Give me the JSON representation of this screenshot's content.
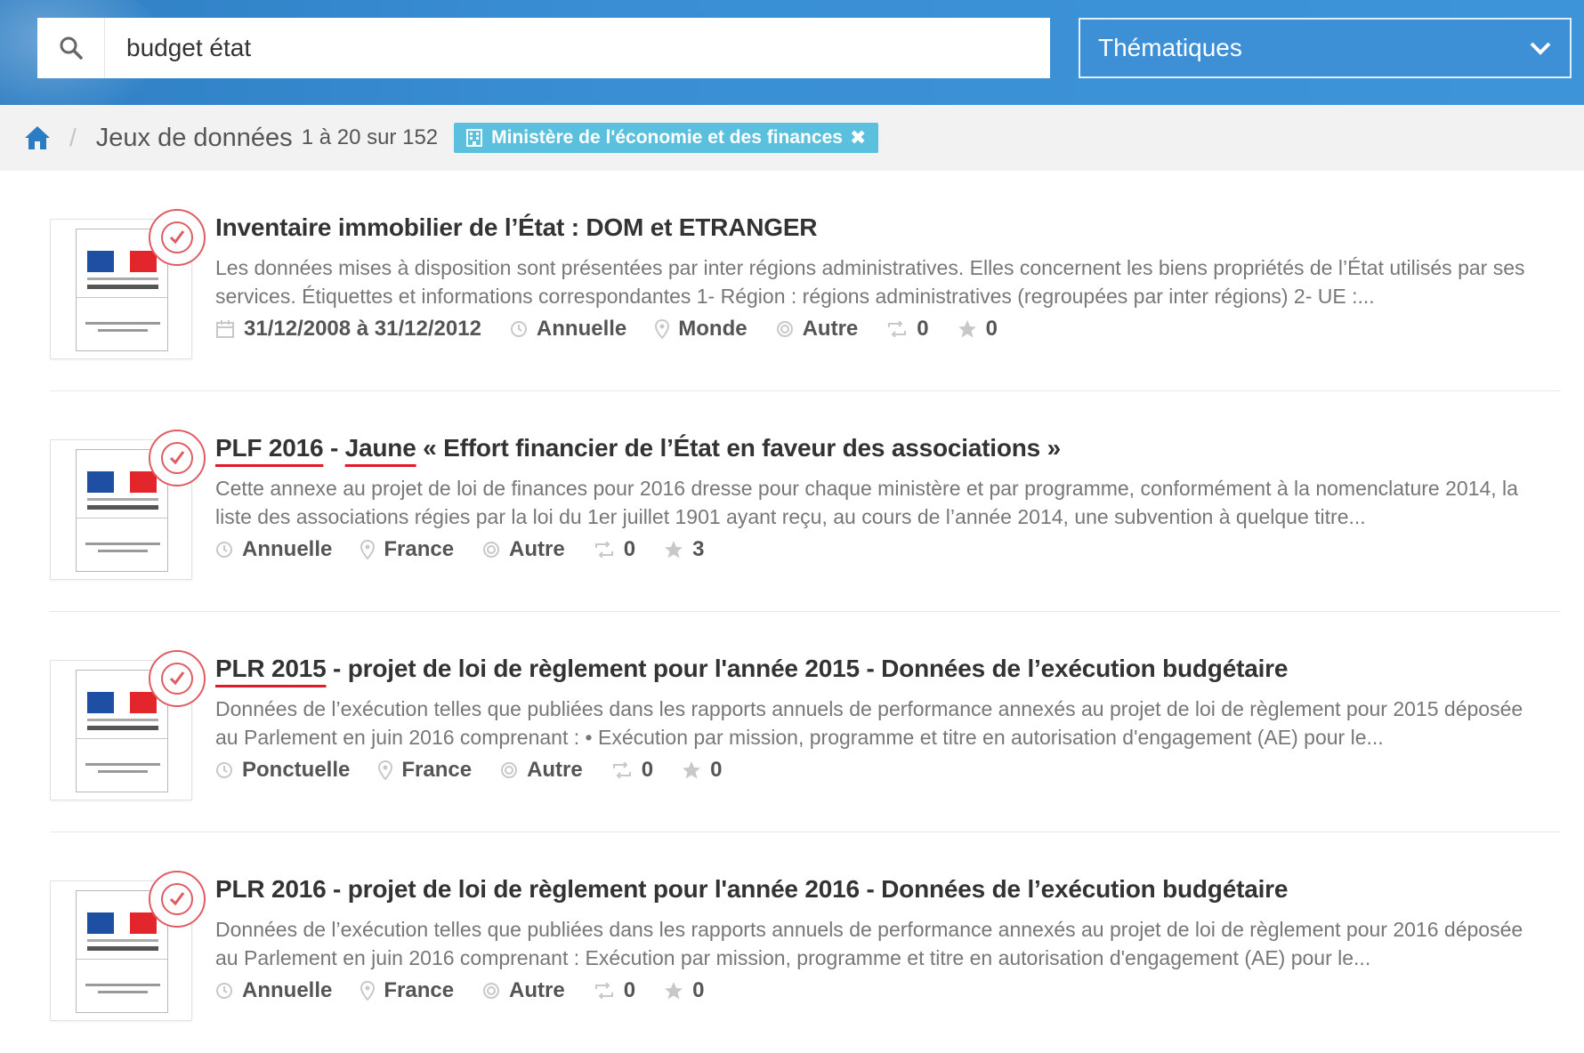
{
  "search": {
    "value": "budget état",
    "placeholder": ""
  },
  "theme_select": {
    "selected": "Thématiques"
  },
  "breadcrumb": {
    "title": "Jeux de données",
    "count": "1 à 20 sur 152",
    "filter_tag": "Ministère de l'économie et des finances"
  },
  "colors": {
    "header_blue": "#3a8fd4",
    "tag_blue": "#5bc0de",
    "highlight_red": "#e0192b",
    "seal_red": "#e05c63"
  },
  "results": [
    {
      "title_parts": [
        {
          "text": "Inventaire immobilier de l’État : DOM et ETRANGER",
          "highlight": false
        }
      ],
      "description": "Les données mises à disposition sont présentées par inter régions administratives. Elles concernent les biens propriétés de l’État utilisés par ses services. Étiquettes et informations correspondantes 1- Région : régions administratives (regroupées par inter régions) 2- UE :...",
      "temporal": "31/12/2008 à 31/12/2012",
      "frequency": "Annuelle",
      "spatial": "Monde",
      "license": "Autre",
      "reuses": "0",
      "stars": "0"
    },
    {
      "title_parts": [
        {
          "text": "PLF 2016",
          "highlight": true
        },
        {
          "text": " - ",
          "highlight": false
        },
        {
          "text": "Jaune",
          "highlight": true
        },
        {
          "text": " « Effort financier de l’État en faveur des associations »",
          "highlight": false
        }
      ],
      "description": "Cette annexe au projet de loi de finances pour 2016 dresse pour chaque ministère et par programme, conformément à la nomenclature 2014, la liste des associations régies par la loi du 1er juillet 1901 ayant reçu, au cours de l’année 2014, une subvention à quelque titre...",
      "temporal": "",
      "frequency": "Annuelle",
      "spatial": "France",
      "license": "Autre",
      "reuses": "0",
      "stars": "3"
    },
    {
      "title_parts": [
        {
          "text": "PLR 2015",
          "highlight": true
        },
        {
          "text": " - projet de loi de règlement pour l'année 2015 - Données de l’exécution budgétaire",
          "highlight": false
        }
      ],
      "description": "Données de l’exécution telles que publiées dans les rapports annuels de performance annexés au projet de loi de règlement pour 2015 déposée au Parlement en juin 2016 comprenant : • Exécution par mission, programme et titre en autorisation d'engagement (AE) pour le...",
      "temporal": "",
      "frequency": "Ponctuelle",
      "spatial": "France",
      "license": "Autre",
      "reuses": "0",
      "stars": "0"
    },
    {
      "title_parts": [
        {
          "text": "PLR 2016 - projet de loi de règlement pour l'année 2016 - Données de l’exécution budgétaire",
          "highlight": false
        }
      ],
      "description": "Données de l’exécution telles que publiées dans les rapports annuels de performance annexés au projet de loi de règlement pour 2016 déposée au Parlement en juin 2016 comprenant : Exécution par mission, programme et titre en autorisation d'engagement (AE) pour le...",
      "temporal": "",
      "frequency": "Annuelle",
      "spatial": "France",
      "license": "Autre",
      "reuses": "0",
      "stars": "0"
    }
  ]
}
